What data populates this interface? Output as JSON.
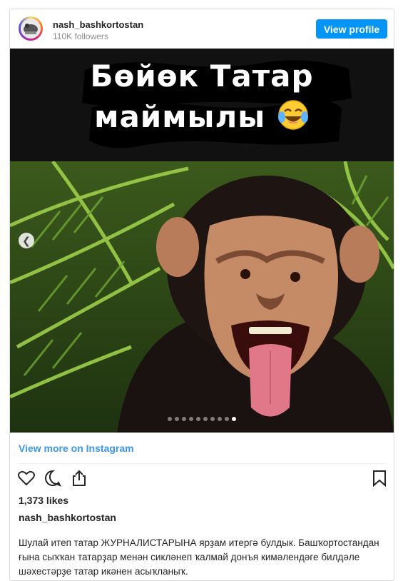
{
  "header": {
    "username": "nash_bashkortostan",
    "followers": "110K followers",
    "view_profile_label": "View profile"
  },
  "media": {
    "overlay_line1": "Бөйөк Татар",
    "overlay_line2": "маймылы",
    "emoji": "laughing-crying-face-icon",
    "carousel_total": 10,
    "carousel_active_index": 9
  },
  "link": {
    "view_more_label": "View more on Instagram"
  },
  "actions": [
    "heart-icon",
    "comment-icon",
    "share-icon",
    "bookmark-icon"
  ],
  "post": {
    "likes": "1,373 likes",
    "poster": "nash_bashkortostan",
    "caption": "Шулай итеп татар ЖУРНАЛИСТАРЫНА ярҙам итергә булдык. Башҡортостандан ғына сыҡҡан татарҙар менән сикләнеп ҡалмай донъя кимәлендәге билдәле шәхестәрҙе татар икәнен асыҡланыҡ."
  },
  "colors": {
    "accent": "#0095f6",
    "link": "#3897f0",
    "text": "#262626",
    "muted": "#8e8e8e"
  }
}
